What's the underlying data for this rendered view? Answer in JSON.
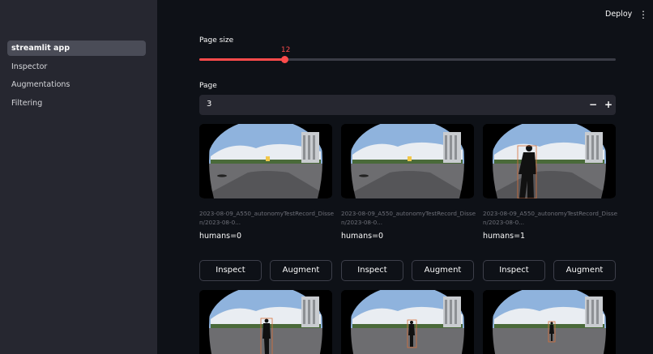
{
  "sidebar": {
    "items": [
      {
        "label": "streamlit app",
        "active": true
      },
      {
        "label": "Inspector",
        "active": false
      },
      {
        "label": "Augmentations",
        "active": false
      },
      {
        "label": "Filtering",
        "active": false
      }
    ]
  },
  "header": {
    "deploy_label": "Deploy",
    "menu_icon": "kebab-menu-icon"
  },
  "page_size": {
    "label": "Page size",
    "value": "12",
    "fraction": 0.206
  },
  "page": {
    "label": "Page",
    "value": "3",
    "minus": "−",
    "plus": "+"
  },
  "cards_row1": [
    {
      "caption_line1": "2023-08-09_A550_autonomyTestRecord_Disse",
      "caption_line2": "n/2023-08-0...",
      "count": "humans=0",
      "person": false
    },
    {
      "caption_line1": "2023-08-09_A550_autonomyTestRecord_Disse",
      "caption_line2": "n/2023-08-0...",
      "count": "humans=0",
      "person": false
    },
    {
      "caption_line1": "2023-08-09_A550_autonomyTestRecord_Disse",
      "caption_line2": "n/2023-08-0...",
      "count": "humans=1",
      "person": true
    }
  ],
  "buttons": {
    "inspect": "Inspect",
    "augment": "Augment"
  },
  "colors": {
    "accent": "#ff4b4b",
    "bg": "#0e1117",
    "sidebar": "#262730"
  }
}
